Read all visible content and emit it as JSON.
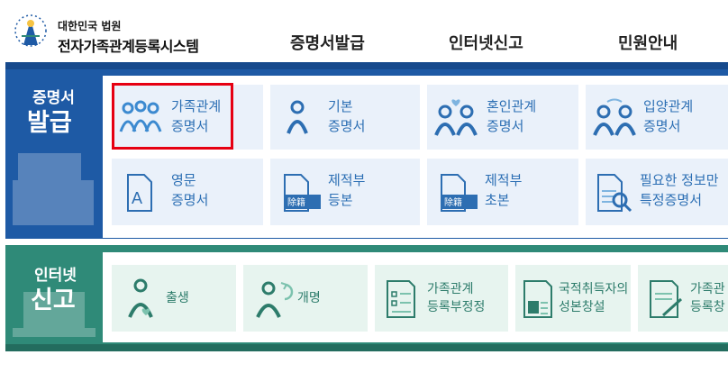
{
  "header": {
    "org": "대한민국 법원",
    "system_name": "전자가족관계등록시스템",
    "nav": [
      "증명서발급",
      "인터넷신고",
      "민원안내"
    ]
  },
  "certificates": {
    "side_top": "증명서",
    "side_bottom": "발급",
    "items": [
      {
        "line1": "가족관계",
        "line2": "증명서"
      },
      {
        "line1": "기본",
        "line2": "증명서"
      },
      {
        "line1": "혼인관계",
        "line2": "증명서"
      },
      {
        "line1": "입양관계",
        "line2": "증명서"
      },
      {
        "line1": "영문",
        "line2": "증명서"
      },
      {
        "line1": "제적부",
        "line2": "등본"
      },
      {
        "line1": "제적부",
        "line2": "초본"
      },
      {
        "line1": "필요한 정보만",
        "line2": "특정증명서"
      }
    ]
  },
  "reports": {
    "side_top": "인터넷",
    "side_bottom": "신고",
    "items": [
      {
        "line1": "출생",
        "line2": ""
      },
      {
        "line1": "개명",
        "line2": ""
      },
      {
        "line1": "가족관계",
        "line2": "등록부정정"
      },
      {
        "line1": "국적취득자의",
        "line2": "성본창설"
      },
      {
        "line1": "가족관",
        "line2": "등록창"
      }
    ]
  },
  "colors": {
    "cert_blue": "#1e5aa5",
    "report_green": "#2f8a78",
    "highlight_red": "#e60012"
  },
  "icons": [
    "court-logo-icon",
    "family-icon",
    "person-icon",
    "marriage-icon",
    "adoption-icon",
    "english-doc-icon",
    "removed-register-icon",
    "birth-icon",
    "rename-icon",
    "form-icon",
    "id-card-icon"
  ]
}
